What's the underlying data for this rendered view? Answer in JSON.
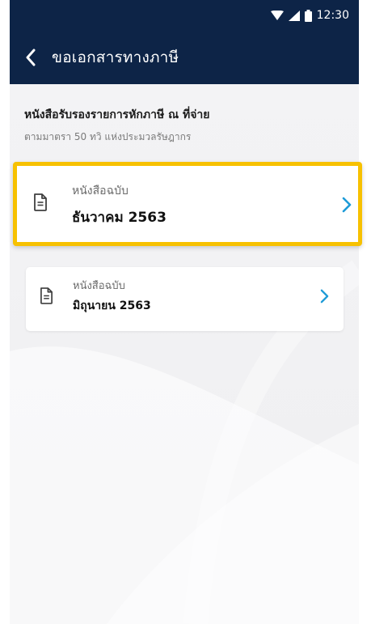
{
  "status_bar": {
    "time": "12:30",
    "icons": [
      "wifi-icon",
      "signal-icon",
      "battery-icon"
    ]
  },
  "app_bar": {
    "back_icon": "chevron-left-icon",
    "title": "ขอเอกสารทางภาษี"
  },
  "section": {
    "title": "หนังสือรับรองรายการหักภาษี ณ ที่จ่าย",
    "subtitle": "ตามมาตรา 50 ทวิ แห่งประมวลรัษฎากร"
  },
  "documents": [
    {
      "label": "หนังสือฉบับ",
      "month": "ธันวาคม 2563",
      "icon": "document-icon",
      "highlighted": true
    },
    {
      "label": "หนังสือฉบับ",
      "month": "มิถุนายน 2563",
      "icon": "document-icon",
      "highlighted": false
    }
  ],
  "colors": {
    "header_bg": "#0d2447",
    "highlight_border": "#f7c100",
    "chevron": "#1e9bd7",
    "page_bg": "#f1f1f3"
  }
}
